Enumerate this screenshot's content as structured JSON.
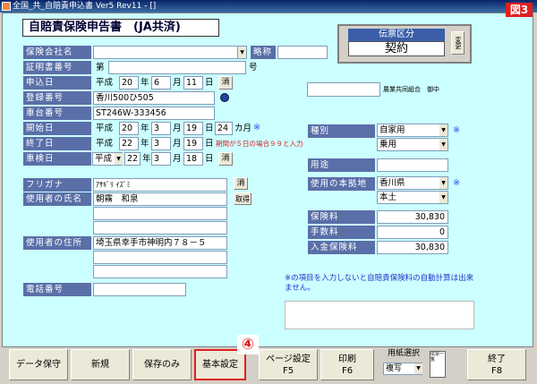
{
  "window": {
    "title": "全国_共_自賠責申込書 Ver5 Rev11 - []"
  },
  "form": {
    "title": "自賠責保険申告書　(JA共済)",
    "badge": "図3",
    "denpyo": {
      "label": "伝票区分",
      "value": "契約",
      "change_btn": "変更"
    }
  },
  "labels": {
    "hoken_gaisha": "保険会社名",
    "ryakusho": "略称",
    "shomeisho": "証明書番号",
    "moushikomi": "申込日",
    "toroku": "登録番号",
    "shadai": "車台番号",
    "kaishi": "開始日",
    "shuryo": "終了日",
    "shaken": "車検日",
    "furigana": "フリガナ",
    "shimei": "使用者の氏名",
    "jusho": "使用者の住所",
    "denwa": "電話番号",
    "shubetsu": "種別",
    "youto": "用途",
    "honkyo": "使用の本拠地",
    "hokenryo": "保険料",
    "tesuryo": "手数料",
    "nyukin": "入金保険料"
  },
  "values": {
    "shomeisho_prefix": "第",
    "shomeisho_suffix": "号",
    "era": "平成",
    "moushikomi": {
      "y": "20",
      "m": "6",
      "d": "11"
    },
    "toroku": "香川500ひ505",
    "shadai": "ST246W-333456",
    "kaishi": {
      "y": "20",
      "m": "3",
      "d": "19"
    },
    "months": "24",
    "months_unit": "カ月",
    "shuryo": {
      "y": "22",
      "m": "3",
      "d": "19"
    },
    "shaken_era": "平成",
    "shaken": {
      "y": "22",
      "m": "3",
      "d": "18"
    },
    "furigana": "ｱｻｷﾞﾘ ｲｽﾞﾐ",
    "shimei": "朝霧　和泉",
    "jusho": "埼玉県幸手市神明内７８－５",
    "kumiai": "農業共同組合　御中",
    "shubetsu1": "自家用",
    "shubetsu2": "乗用",
    "honkyo1": "香川県",
    "honkyo2": "本土",
    "hokenryo": "30,830",
    "tesuryo": "0",
    "nyukin": "30,830"
  },
  "units": {
    "nen": "年",
    "tsuki": "月",
    "hi": "日"
  },
  "buttons": {
    "kesu": "消",
    "toriyose": "取得",
    "data_hozon": "データ保守",
    "shinki": "新規",
    "hozon_nomi": "保存のみ",
    "kihon_settei": "基本設定",
    "page_settei": "ページ設定",
    "page_key": "F5",
    "insatsu": "印刷",
    "insatsu_key": "F6",
    "shuryo": "終了",
    "shuryo_key": "F8"
  },
  "notes": {
    "period": "期間が５日の場合９９と入力",
    "mark": "※",
    "bottom_note": "※の項目を入力しないと自賠責保険料の自動計算は出来ません。",
    "step": "④"
  },
  "paper": {
    "label": "用紙選択",
    "value": "複写",
    "icon": "伝票一覧"
  }
}
